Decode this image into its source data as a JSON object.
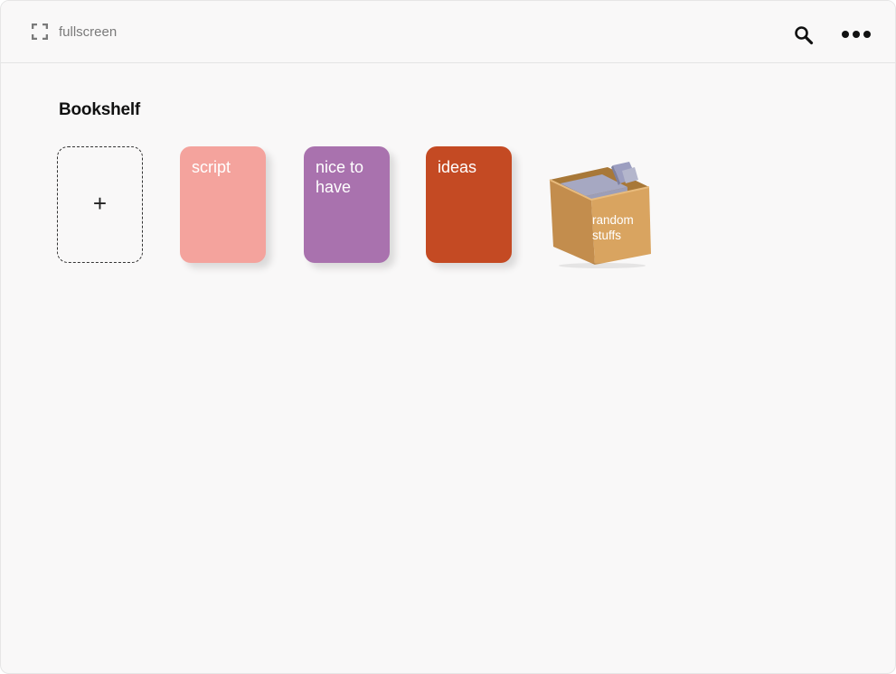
{
  "topbar": {
    "fullscreen_icon": "fullscreen-icon",
    "fullscreen_label": "fullscreen",
    "search_icon": "search-icon",
    "more_icon": "more-dots-icon"
  },
  "shelf": {
    "title": "Bookshelf",
    "add_label": "+",
    "books": [
      {
        "label": "script",
        "color": "#f4a39d"
      },
      {
        "label": "nice to have",
        "color": "#a972ae"
      },
      {
        "label": "ideas",
        "color": "#c44a23"
      }
    ],
    "box": {
      "label": "random stuffs",
      "icon": "cardboard-box-icon",
      "color": "#d9a460"
    }
  }
}
